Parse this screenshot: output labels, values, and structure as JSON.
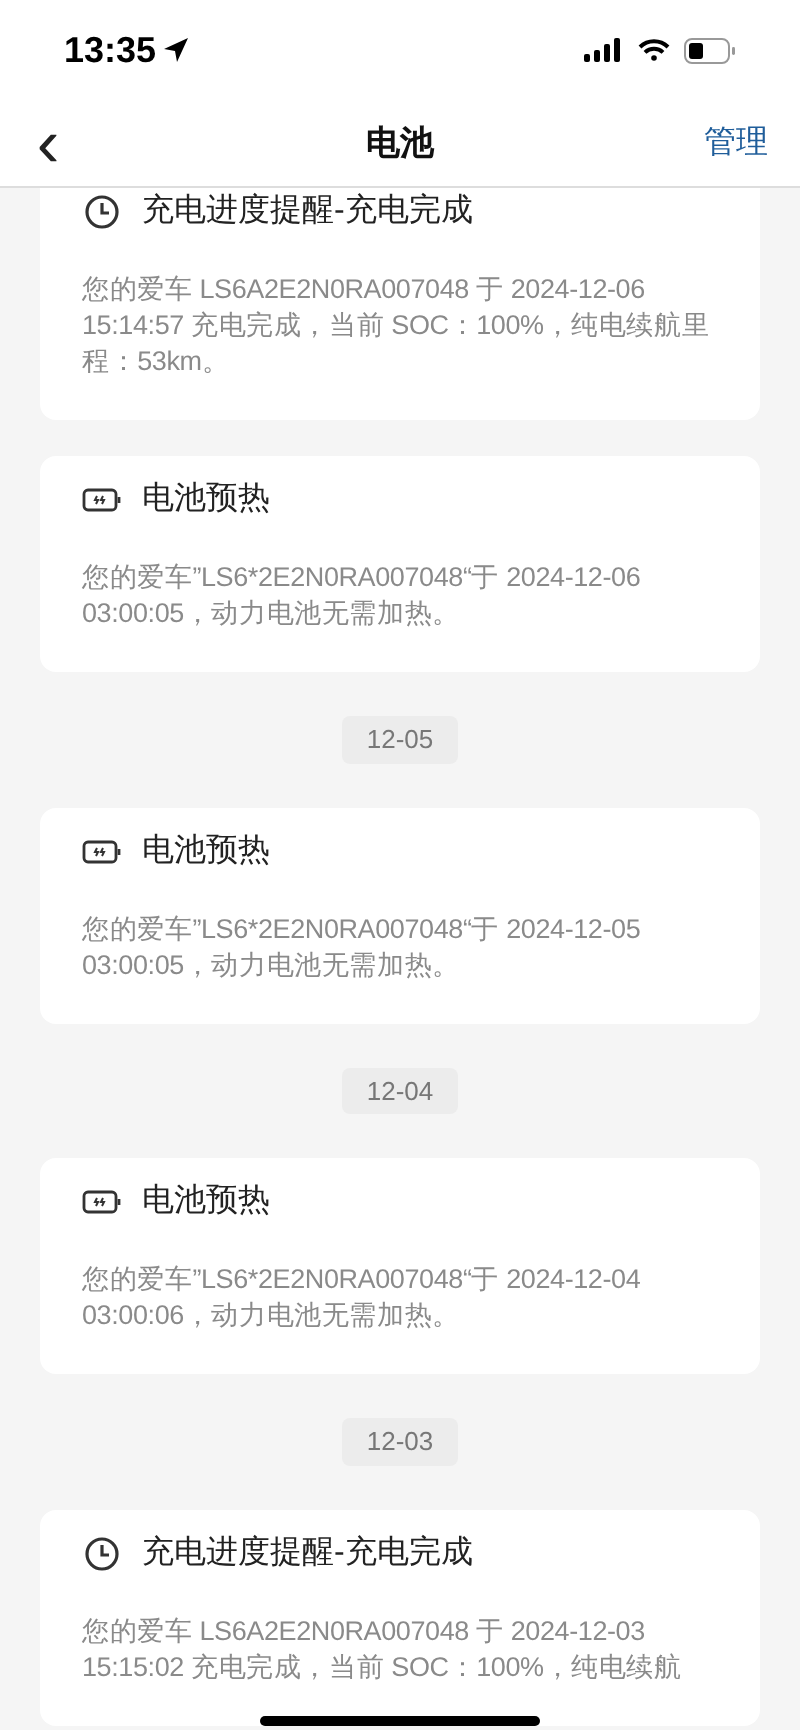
{
  "status_bar": {
    "time": "13:35"
  },
  "nav": {
    "back": "‹",
    "title": "电池",
    "action": "管理"
  },
  "feed": [
    {
      "kind": "charge",
      "title": "充电进度提醒-充电完成",
      "body": "您的爱车 LS6A2E2N0RA007048 于 2024-12-06 15:14:57 充电完成，当前 SOC：100%，纯电续航里程：53km。"
    },
    {
      "kind": "preheat",
      "title": "电池预热",
      "body": "您的爱车”LS6*2E2N0RA007048“于 2024-12-06 03:00:05，动力电池无需加热。"
    },
    {
      "kind": "date",
      "label": "12-05"
    },
    {
      "kind": "preheat",
      "title": "电池预热",
      "body": "您的爱车”LS6*2E2N0RA007048“于 2024-12-05 03:00:05，动力电池无需加热。"
    },
    {
      "kind": "date",
      "label": "12-04"
    },
    {
      "kind": "preheat",
      "title": "电池预热",
      "body": "您的爱车”LS6*2E2N0RA007048“于 2024-12-04 03:00:06，动力电池无需加热。"
    },
    {
      "kind": "date",
      "label": "12-03"
    },
    {
      "kind": "charge",
      "title": "充电进度提醒-充电完成",
      "body": "您的爱车 LS6A2E2N0RA007048 于 2024-12-03 15:15:02 充电完成，当前 SOC：100%，纯电续航"
    }
  ]
}
